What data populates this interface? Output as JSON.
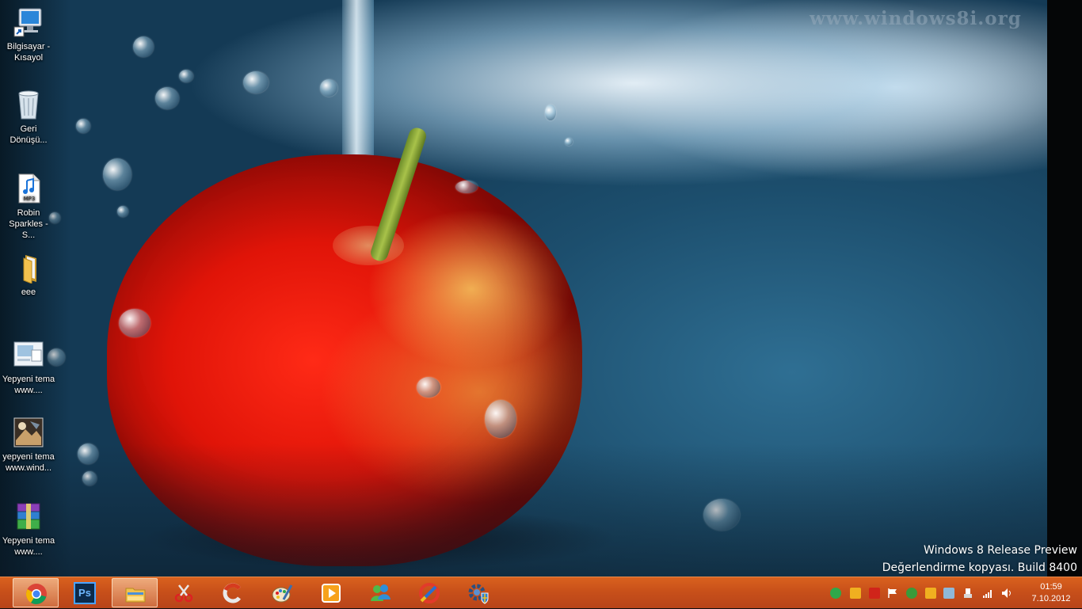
{
  "desktop": {
    "icons": [
      {
        "label": "Bilgisayar - Kısayol",
        "icon": "computer-shortcut-icon"
      },
      {
        "label": "Geri Dönüşü...",
        "icon": "recycle-bin-icon"
      },
      {
        "label": "Robin Sparkles - S...",
        "icon": "mp3-file-icon"
      },
      {
        "label": "eee",
        "icon": "folder-icon"
      },
      {
        "label": "Yepyeni tema www....",
        "icon": "theme-file-icon"
      },
      {
        "label": "yepyeni tema www.wind...",
        "icon": "theme-image-icon"
      },
      {
        "label": "Yepyeni tema www....",
        "icon": "winrar-archive-icon"
      }
    ],
    "watermark": "www.windows8i.org",
    "build_line1": "Windows 8 Release Preview",
    "build_line2": "Değerlendirme kopyası. Build 8400"
  },
  "taskbar": {
    "color": "#c8501a",
    "apps": [
      {
        "icon": "chrome-icon",
        "active": true
      },
      {
        "icon": "photoshop-icon",
        "label": "Ps",
        "active": false
      },
      {
        "icon": "file-explorer-icon",
        "active": true
      },
      {
        "icon": "snipping-tool-icon",
        "active": false
      },
      {
        "icon": "ccleaner-icon",
        "active": false
      },
      {
        "icon": "paint-icon",
        "active": false
      },
      {
        "icon": "media-player-icon",
        "active": false
      },
      {
        "icon": "messenger-icon",
        "active": false
      },
      {
        "icon": "ccleaner-brush-icon",
        "active": false
      },
      {
        "icon": "settings-gear-shield-icon",
        "active": false
      }
    ],
    "tray_icons": [
      "update-icon",
      "alert-icon",
      "adobe-icon",
      "flag-icon",
      "network-share-icon",
      "kaspersky-icon",
      "security-icon",
      "usb-icon",
      "signal-icon",
      "volume-icon"
    ],
    "clock": {
      "time": "01:59",
      "date": "7.10.2012"
    }
  }
}
